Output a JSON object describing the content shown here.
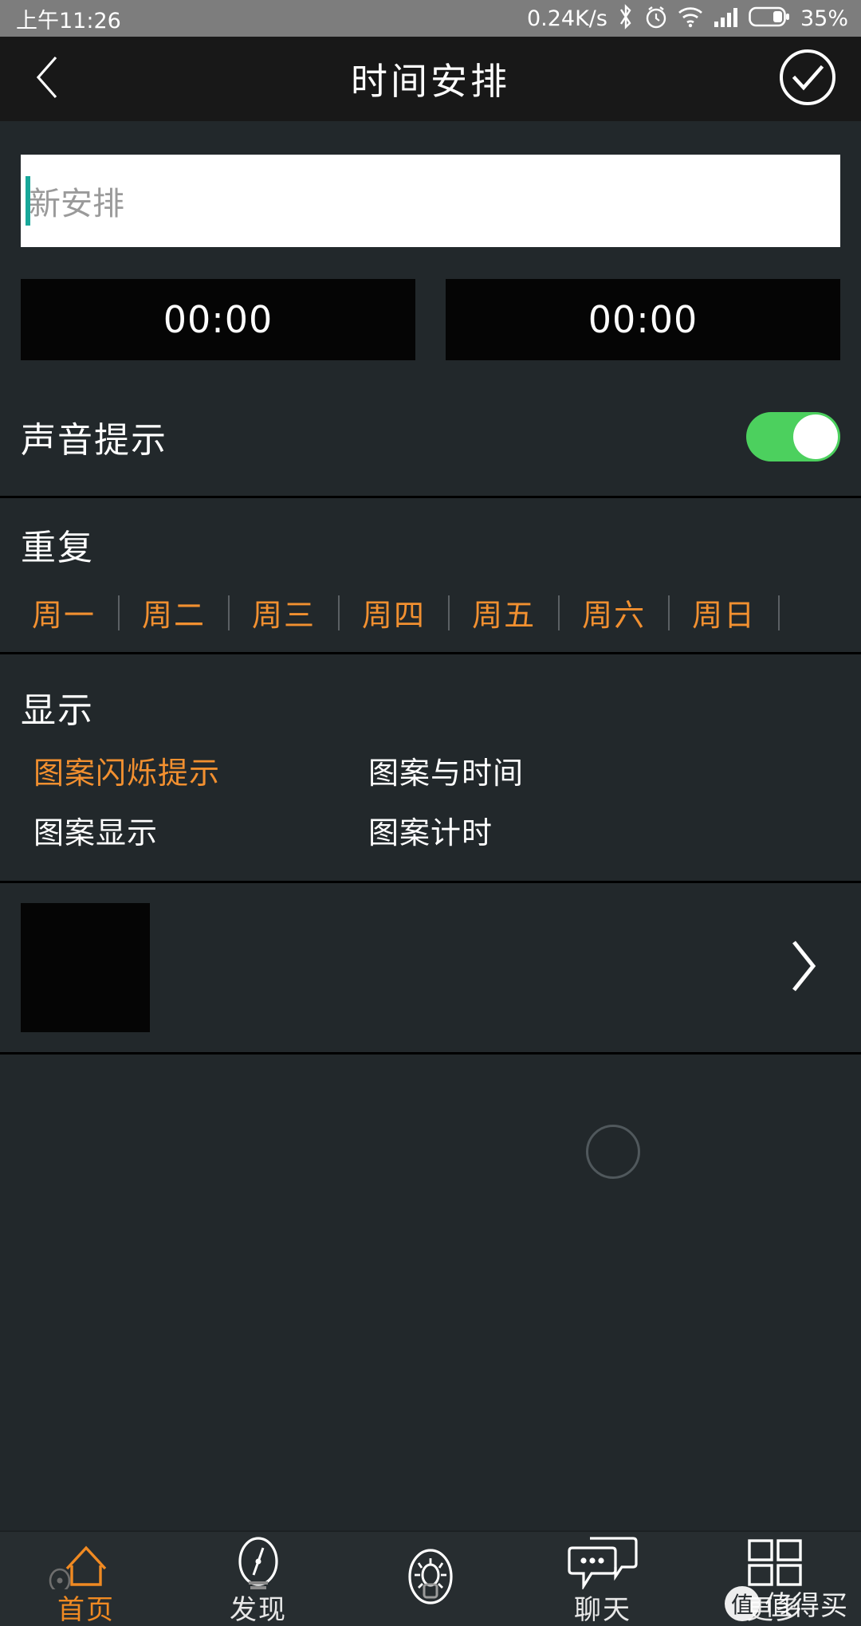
{
  "status_bar": {
    "time": "上午11:26",
    "network_speed": "0.24K/s",
    "battery_percent": "35%",
    "icons": [
      "bluetooth-icon",
      "alarm-icon",
      "wifi-icon",
      "cellular-signal-icon",
      "battery-icon"
    ]
  },
  "header": {
    "title": "时间安排",
    "back_icon": "chevron-left-icon",
    "confirm_icon": "check-circle-icon"
  },
  "schedule": {
    "name_placeholder": "新安排",
    "name_value": "",
    "start_time": "00:00",
    "end_time": "00:00"
  },
  "sound": {
    "label": "声音提示",
    "enabled": "true"
  },
  "repeat": {
    "title": "重复",
    "days": [
      "周一",
      "周二",
      "周三",
      "周四",
      "周五",
      "周六",
      "周日"
    ]
  },
  "display": {
    "title": "显示",
    "options": [
      {
        "label": "图案闪烁提示",
        "selected": "true"
      },
      {
        "label": "图案与时间",
        "selected": "false"
      },
      {
        "label": "图案显示",
        "selected": "false"
      },
      {
        "label": "图案计时",
        "selected": "false"
      }
    ]
  },
  "pattern_row": {
    "thumbnail": "black-pattern-thumbnail",
    "chevron_icon": "chevron-right-icon"
  },
  "bottom_nav": {
    "items": [
      {
        "label": "首页",
        "icon": "home-icon",
        "active": "true"
      },
      {
        "label": "发现",
        "icon": "compass-icon",
        "active": "false"
      },
      {
        "label": "",
        "icon": "bulb-icon",
        "active": "false"
      },
      {
        "label": "聊天",
        "icon": "chat-icon",
        "active": "false"
      },
      {
        "label": "更多",
        "icon": "grid-icon",
        "active": "false"
      }
    ]
  },
  "watermark": {
    "badge": "值",
    "text": "值得买"
  },
  "colors": {
    "accent_orange": "#f29030",
    "toggle_green": "#4cd05e",
    "caret_teal": "#18a89a",
    "background": "#22282b",
    "header_background": "#181818",
    "statusbar_background": "#7d7d7d"
  }
}
